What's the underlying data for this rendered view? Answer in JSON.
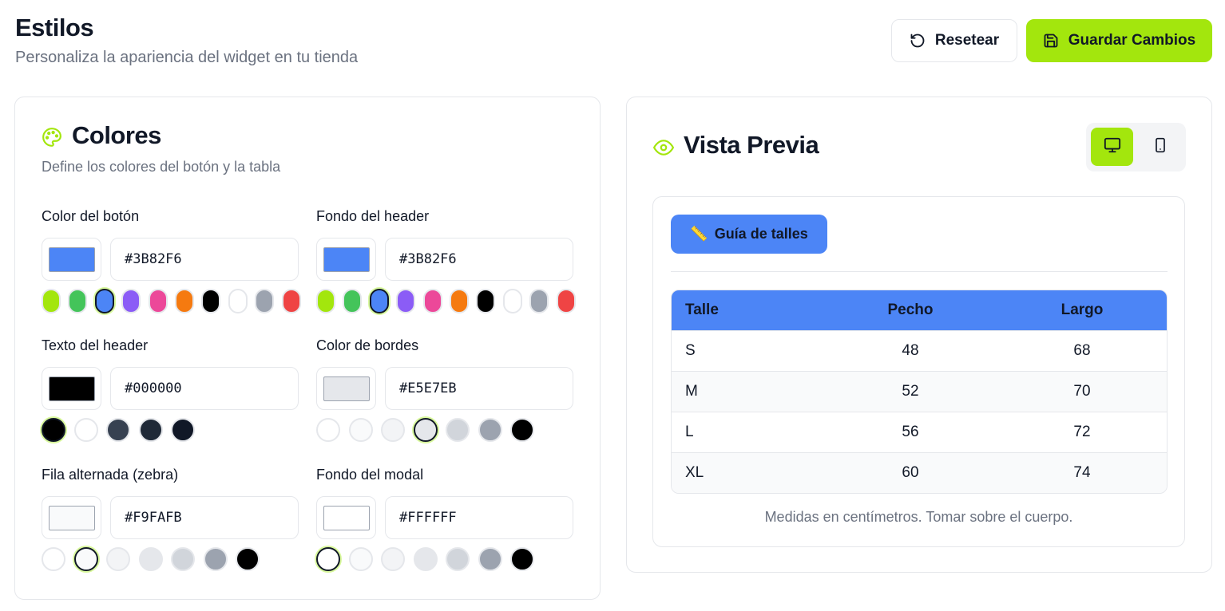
{
  "header": {
    "title": "Estilos",
    "subtitle": "Personaliza la apariencia del widget en tu tienda",
    "reset_label": "Resetear",
    "save_label": "Guardar Cambios"
  },
  "theme": {
    "accent": "#a3e60d",
    "border": "#e5e7eb",
    "muted_text": "#6b7280"
  },
  "colors": {
    "title": "Colores",
    "subtitle": "Define los colores del botón y la tabla",
    "icon": "palette-icon",
    "fields": [
      {
        "label": "Color del botón",
        "value": "#3B82F6",
        "swatch": "#4c85f6",
        "selected": 2,
        "presets": [
          "#a3e60d",
          "#44c45a",
          "#4c85f6",
          "#8b5cf6",
          "#ec4899",
          "#f57a10",
          "#000000",
          "#ffffff",
          "#9ca3af",
          "#ef4444"
        ]
      },
      {
        "label": "Fondo del header",
        "value": "#3B82F6",
        "swatch": "#4c85f6",
        "selected": 2,
        "presets": [
          "#a3e60d",
          "#44c45a",
          "#4c85f6",
          "#8b5cf6",
          "#ec4899",
          "#f57a10",
          "#000000",
          "#ffffff",
          "#9ca3af",
          "#ef4444"
        ]
      },
      {
        "label": "Texto del header",
        "value": "#000000",
        "swatch": "#000000",
        "selected": 0,
        "presets": [
          "#000000",
          "#ffffff",
          "#374151",
          "#1f2937",
          "#111827"
        ]
      },
      {
        "label": "Color de bordes",
        "value": "#E5E7EB",
        "swatch": "#e5e7eb",
        "selected": 3,
        "presets": [
          "#ffffff",
          "#f9fafb",
          "#f3f4f6",
          "#e5e7eb",
          "#d1d5db",
          "#9ca3af",
          "#000000"
        ]
      },
      {
        "label": "Fila alternada (zebra)",
        "value": "#F9FAFB",
        "swatch": "#f9fafb",
        "selected": 1,
        "presets": [
          "#ffffff",
          "#f9fafb",
          "#f3f4f6",
          "#e5e7eb",
          "#d1d5db",
          "#9ca3af",
          "#000000"
        ]
      },
      {
        "label": "Fondo del modal",
        "value": "#FFFFFF",
        "swatch": "#ffffff",
        "selected": 0,
        "presets": [
          "#ffffff",
          "#f9fafb",
          "#f3f4f6",
          "#e5e7eb",
          "#d1d5db",
          "#9ca3af",
          "#000000"
        ]
      }
    ]
  },
  "preview": {
    "title": "Vista Previa",
    "icon": "eye-icon",
    "device_desktop_icon": "monitor-icon",
    "device_mobile_icon": "smartphone-icon",
    "active_device": "desktop",
    "guide_button": {
      "emoji": "📏",
      "label": "Guía de talles"
    },
    "table": {
      "header_bg": "#4c85f6",
      "columns": [
        "Talle",
        "Pecho",
        "Largo"
      ],
      "rows": [
        [
          "S",
          "48",
          "68"
        ],
        [
          "M",
          "52",
          "70"
        ],
        [
          "L",
          "56",
          "72"
        ],
        [
          "XL",
          "60",
          "74"
        ]
      ]
    },
    "footnote": "Medidas en centímetros. Tomar sobre el cuerpo."
  }
}
